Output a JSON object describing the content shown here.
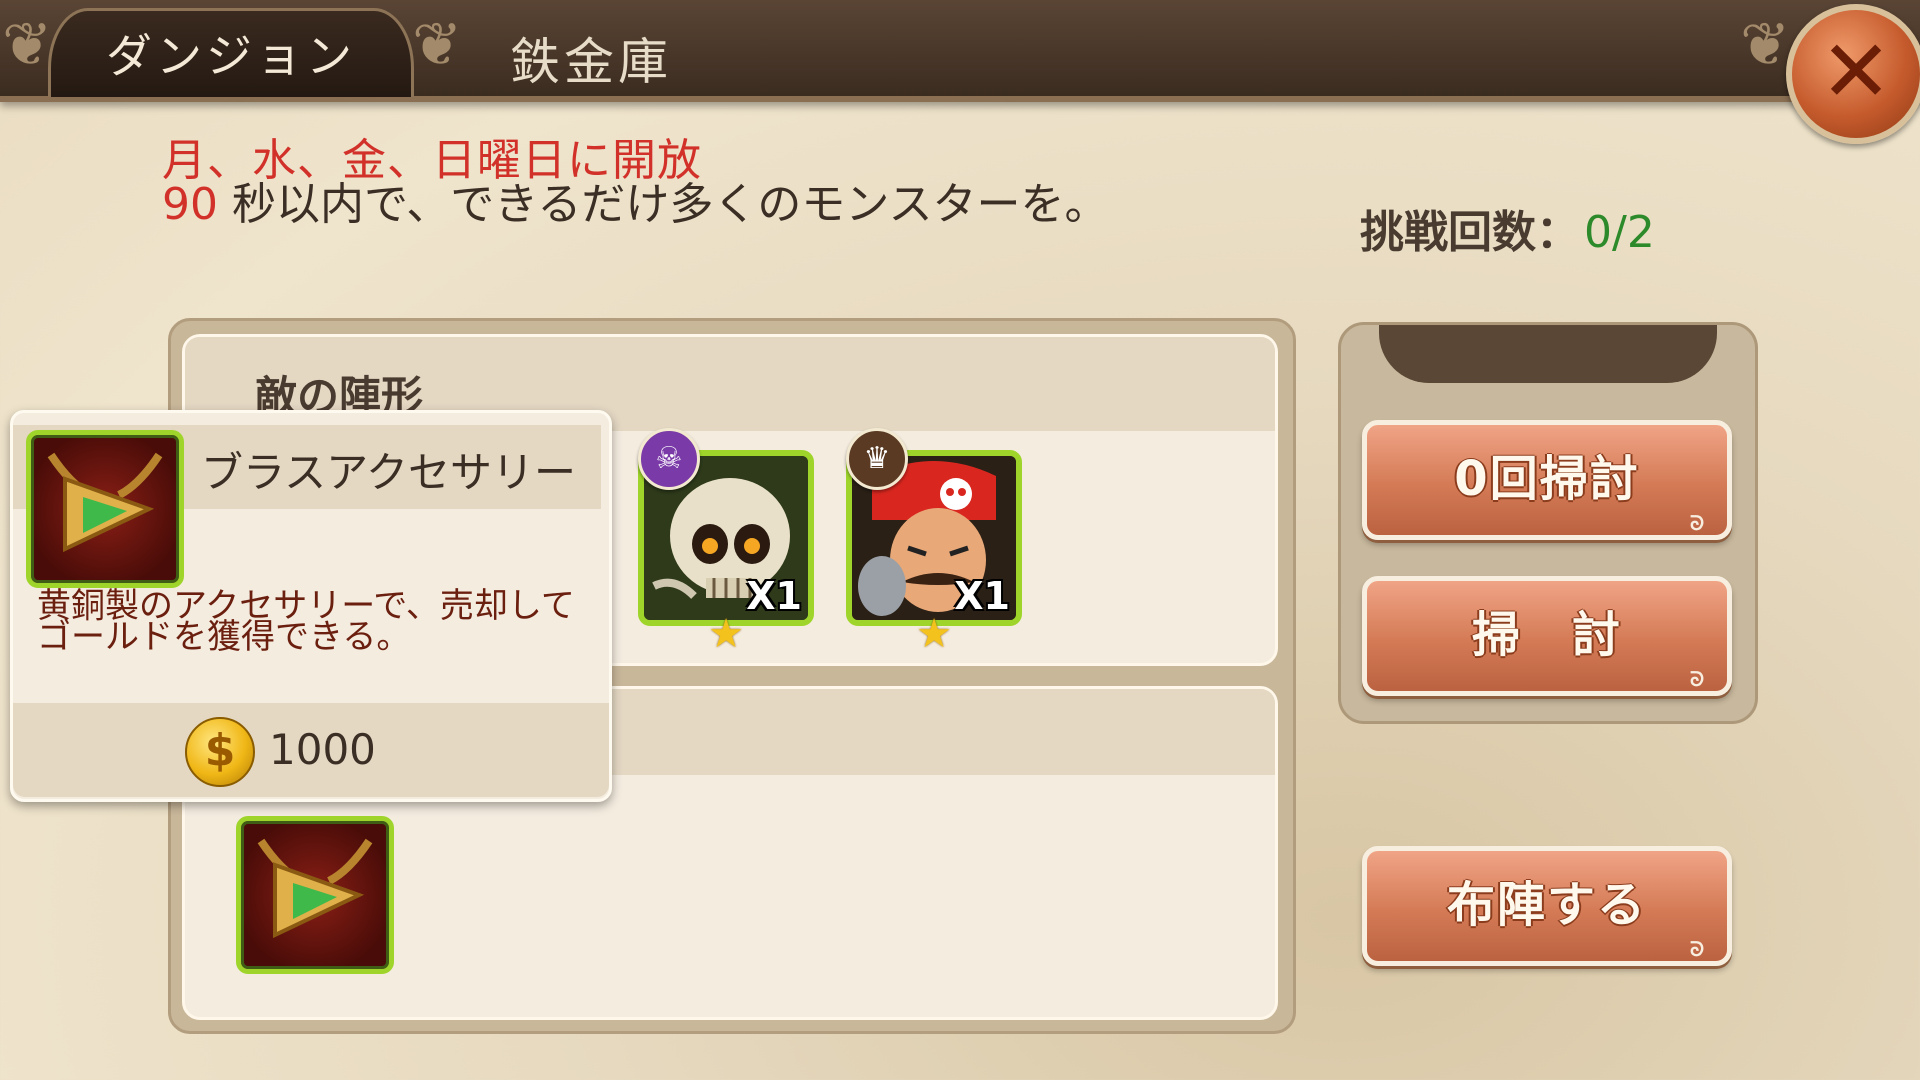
{
  "header": {
    "tab_label": "ダンジョン",
    "title": "鉄金庫"
  },
  "info": {
    "open_days": "月、水、金、日曜日に開放",
    "time_seconds": "90",
    "description": "秒以内で、できるだけ多くのモンスターを。",
    "attempts_label": "挑戦回数：",
    "attempts_value": "0/2"
  },
  "enemy_section": {
    "title": "敵の陣形",
    "units": [
      {
        "name": "skeleton",
        "count": "X1",
        "stars": 1,
        "badge": "demon-icon"
      },
      {
        "name": "pirate",
        "count": "X1",
        "stars": 1,
        "badge": "crown-icon"
      }
    ]
  },
  "reward_section": {
    "items": [
      {
        "name": "brass-accessory-icon"
      }
    ]
  },
  "tooltip": {
    "item_name": "ブラスアクセサリー",
    "description_line1": "黄銅製のアクセサリーで、売却して",
    "description_line2": "ゴールドを獲得できる。",
    "price": "1000"
  },
  "actions": {
    "sweep_count_label": "0回掃討",
    "sweep_label": "掃　討",
    "formation_label": "布陣する"
  },
  "colors": {
    "accent_red": "#d2312a",
    "attempts_green": "#2d8a2b",
    "button_orange": "#d47a55",
    "frame_green": "#9fd52b"
  }
}
